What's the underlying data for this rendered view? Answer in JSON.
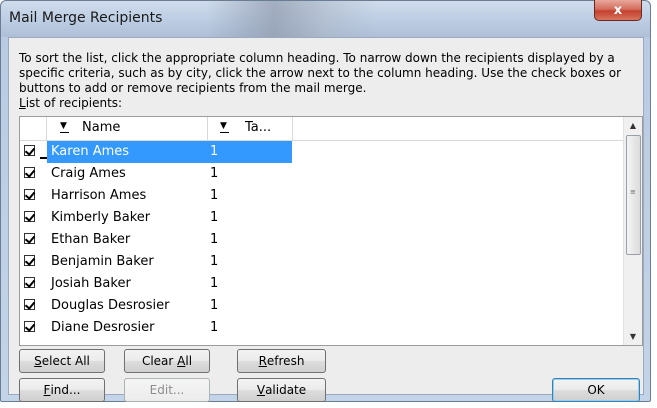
{
  "window": {
    "title": "Mail Merge Recipients",
    "close_symbol": "x"
  },
  "instructions": {
    "line1": "To sort the list, click the appropriate column heading.  To narrow down the recipients displayed by a",
    "line2": "specific criteria, such as by city, click the arrow next to the column heading.  Use the check boxes or",
    "line3": "buttons to add or remove recipients from the mail merge."
  },
  "list_label": {
    "mnemonic": "L",
    "rest": "ist of recipients:"
  },
  "columns": [
    {
      "label": "Name"
    },
    {
      "label": "Ta..."
    }
  ],
  "rows": [
    {
      "name": "Karen Ames",
      "value": "1",
      "checked": true,
      "selected": true
    },
    {
      "name": "Craig Ames",
      "value": "1",
      "checked": true
    },
    {
      "name": "Harrison Ames",
      "value": "1",
      "checked": true
    },
    {
      "name": "Kimberly Baker",
      "value": "1",
      "checked": true
    },
    {
      "name": "Ethan Baker",
      "value": "1",
      "checked": true
    },
    {
      "name": "Benjamin Baker",
      "value": "1",
      "checked": true
    },
    {
      "name": "Josiah Baker",
      "value": "1",
      "checked": true
    },
    {
      "name": "Douglas Desrosier",
      "value": "1",
      "checked": true
    },
    {
      "name": "Diane Desrosier",
      "value": "1",
      "checked": true
    }
  ],
  "buttons": {
    "select_all": {
      "mn": "S",
      "rest": "elect All"
    },
    "clear_all": {
      "pre": "Clear ",
      "mn": "A",
      "rest": "ll"
    },
    "refresh": {
      "mn": "R",
      "rest": "efresh"
    },
    "find": {
      "mn": "F",
      "rest": "ind..."
    },
    "edit": "Edit...",
    "validate": {
      "mn": "V",
      "rest": "alidate"
    },
    "ok": "OK"
  },
  "colors": {
    "selection": "#3399ff",
    "close": "#c4412e"
  }
}
